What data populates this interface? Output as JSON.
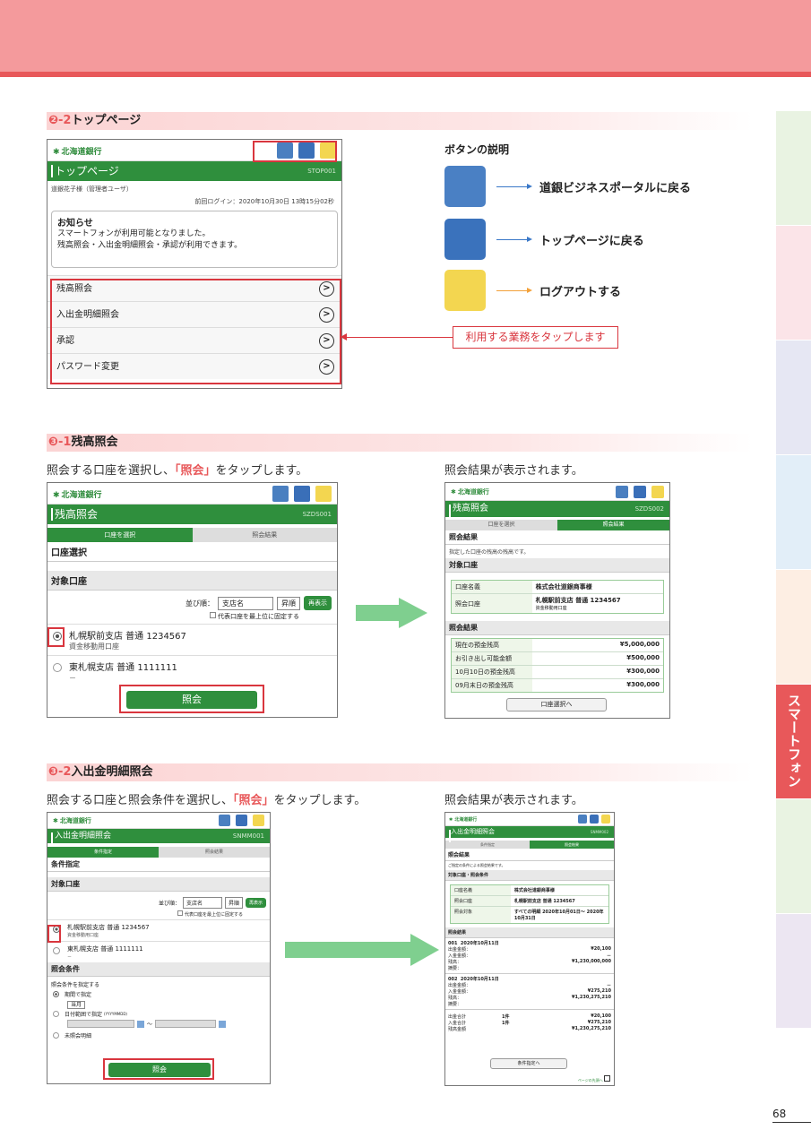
{
  "side_tab": {
    "label": "スマートフォン"
  },
  "page_number": "68",
  "section_top": {
    "num": "❷-2",
    "title": "トップページ"
  },
  "top_phone": {
    "logo": "北海道銀行",
    "bar_title": "トップページ",
    "bar_code": "STOP001",
    "user": "道銀花子様（管理者ユーザ）",
    "last_login": "前回ログイン：2020年10月30日 13時15分02秒",
    "notice_title": "お知らせ",
    "notice_lines": [
      "スマートフォンが利用可能となりました。",
      "残高照会・入出金明細照会・承認が利用できます。"
    ],
    "menu": [
      "残高照会",
      "入出金明細照会",
      "承認",
      "パスワード変更"
    ]
  },
  "buttons_legend": {
    "title": "ボタンの説明",
    "items": [
      {
        "icon": "ld-portal-icon",
        "text": "道銀ビジネスポータルに戻る",
        "color": "#3a78c8"
      },
      {
        "icon": "home-icon",
        "text": "トップページに戻る",
        "color": "#3a78c8"
      },
      {
        "icon": "logout-icon",
        "text": "ログアウトする",
        "color": "#f3a13a"
      }
    ]
  },
  "callout": "利用する業務をタップします",
  "section_31": {
    "num": "❸-1",
    "title": "残高照会"
  },
  "cap_31_left": {
    "pre": "照会する口座を選択し、",
    "hl": "「照会」",
    "post": "をタップします。"
  },
  "cap_31_right": "照会結果が表示されます。",
  "balance_phone": {
    "bar_title": "残高照会",
    "bar_code": "SZDS001",
    "steps": [
      "口座を選択",
      "照会結果"
    ],
    "sub1": "口座選択",
    "sub2": "対象口座",
    "sort_label": "並び順：",
    "sort_value": "支店名",
    "order_value": "昇順",
    "redisplay": "再表示",
    "rep_check": "代表口座を最上位に固定する",
    "accounts": [
      {
        "name": "札幌駅前支店 普通 1234567",
        "sub": "資金移動用口座"
      },
      {
        "name": "東札幌支店 普通 1111111",
        "sub": "－"
      }
    ],
    "button": "照会"
  },
  "balance_result": {
    "bar_title": "残高照会",
    "bar_code": "SZDS002",
    "steps": [
      "口座を選択",
      "照会結果"
    ],
    "sub1": "照会結果",
    "desc": "指定した口座の残高の残高です。",
    "sub2": "対象口座",
    "account_rows": [
      {
        "k": "口座名義",
        "v": "株式会社道銀商事様"
      },
      {
        "k": "照会口座",
        "v": "札幌駅前支店 普通 1234567",
        "v2": "資金移動用口座"
      }
    ],
    "sub3": "照会結果",
    "balance_rows": [
      {
        "k": "現在の預金残高",
        "v": "¥5,000,000"
      },
      {
        "k": "お引き出し可能金額",
        "v": "¥500,000"
      },
      {
        "k": "10月10日の預金残高",
        "v": "¥300,000"
      },
      {
        "k": "09月末日の預金残高",
        "v": "¥300,000"
      }
    ],
    "button": "口座選択へ"
  },
  "section_32": {
    "num": "❸-2",
    "title": "入出金明細照会"
  },
  "cap_32_left": {
    "pre": "照会する口座と照会条件を選択し、",
    "hl": "「照会」",
    "post": "をタップします。"
  },
  "cap_32_right": "照会結果が表示されます。",
  "detail_phone": {
    "bar_title": "入出金明細照会",
    "bar_code": "SNMM001",
    "steps": [
      "条件指定",
      "照会結果"
    ],
    "sub1": "条件指定",
    "sub2": "対象口座",
    "sort_label": "並び順：",
    "sort_value": "支店名",
    "order_value": "昇順",
    "redisplay": "再表示",
    "rep_check": "代表口座を最上位に固定する",
    "accounts": [
      {
        "name": "札幌駅前支店 普通 1234567",
        "sub": "資金移動用口座"
      },
      {
        "name": "東札幌支店 普通 1111111",
        "sub": "－"
      }
    ],
    "sub3": "照会条件",
    "cond_label": "照会条件を指定する",
    "opt1": "期間で指定",
    "opt1_value": "当月",
    "opt2": "日付範囲で指定",
    "opt2_hint": "(YYYYMMDD)",
    "opt3": "未照会明細",
    "button": "照会"
  },
  "detail_result": {
    "bar_title": "入出金明細照会",
    "bar_code": "SNMM002",
    "steps": [
      "条件指定",
      "照会結果"
    ],
    "sub1": "照会結果",
    "desc": "ご指定の条件による照会結果です。",
    "sub2": "対象口座・照会条件",
    "cond_rows": [
      {
        "k": "口座名義",
        "v": "株式会社道銀商事様"
      },
      {
        "k": "照会口座",
        "v": "札幌駅前支店 普通 1234567"
      },
      {
        "k": "照会対象",
        "v": "すべての明細 2020年10月01日〜 2020年10月31日"
      }
    ],
    "sub3": "照会結果",
    "entries": [
      {
        "no": "001",
        "date": "2020年10月11日",
        "out": "¥20,100",
        "in": "－",
        "bal": "¥1,230,000,000"
      },
      {
        "no": "002",
        "date": "2020年10月11日",
        "out": "－",
        "in": "¥275,210",
        "bal": "¥1,230,275,210"
      }
    ],
    "labels": {
      "out": "出金金額：",
      "in": "入金金額：",
      "bal": "残高：",
      "memo": "摘要："
    },
    "totals": [
      {
        "k": "出金合計",
        "c": "1件",
        "v": "¥20,100"
      },
      {
        "k": "入金合計",
        "c": "1件",
        "v": "¥275,210"
      },
      {
        "k": "残高金額",
        "c": "",
        "v": "¥1,230,275,210"
      }
    ],
    "button": "条件指定へ",
    "page_top": "ページの先頭へ"
  }
}
